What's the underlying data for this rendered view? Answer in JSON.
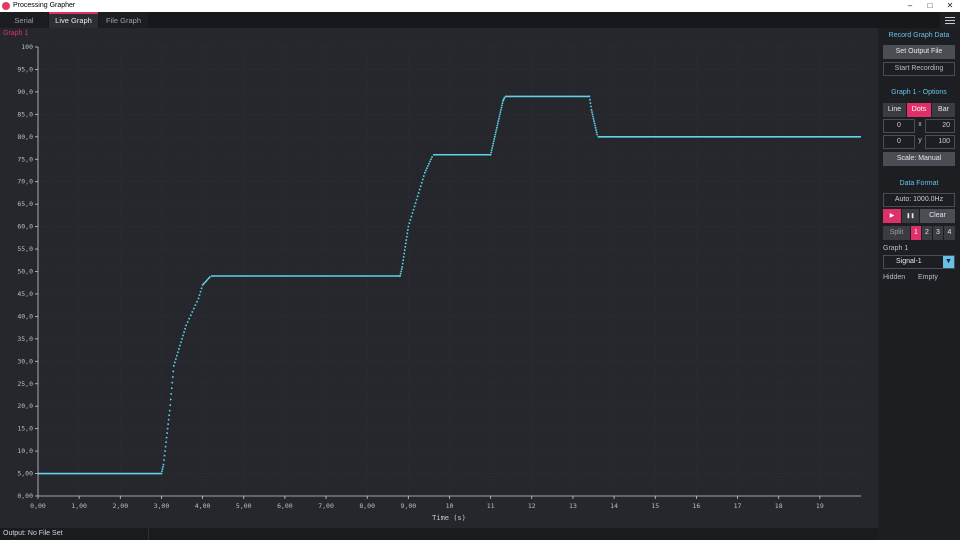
{
  "app": {
    "title": "Processing Grapher"
  },
  "tabs": [
    "Serial",
    "Live Graph",
    "File Graph"
  ],
  "graph": {
    "name": "Graph 1",
    "xlabel": "Time (s)"
  },
  "sidebar": {
    "record_title": "Record Graph Data",
    "set_output_label": "Set Output File",
    "start_recording_label": "Start Recording",
    "options_title": "Graph 1 - Options",
    "type_buttons": [
      "Line",
      "Dots",
      "Bar"
    ],
    "active_type": "Dots",
    "x_min": "0",
    "x_sep": "x",
    "x_max": "20",
    "y_min": "0",
    "y_sep": "y",
    "y_max": "100",
    "scale_label": "Scale: Manual",
    "data_format_title": "Data Format",
    "rate_label": "Auto: 1000.0Hz",
    "play_icon": "▶",
    "pause_icon": "❚❚",
    "clear_label": "Clear",
    "split_label": "Split",
    "split_options": [
      "1",
      "2",
      "3",
      "4"
    ],
    "active_split": "1",
    "graph_select_label": "Graph 1",
    "signal_value": "Signal-1",
    "hidden_label": "Hidden",
    "empty_label": "Empty"
  },
  "status": {
    "text": "Output: No File Set"
  },
  "colors": {
    "accent": "#e0306a",
    "signal": "#5fd3ea",
    "panel_title": "#67c0e8"
  },
  "chart_data": {
    "type": "scatter",
    "xlim": [
      0,
      20
    ],
    "ylim": [
      0,
      100
    ],
    "xticks": [
      "0,00",
      "1,00",
      "2,00",
      "3,00",
      "4,00",
      "5,00",
      "6,00",
      "7,00",
      "8,00",
      "9,00",
      "10",
      "11",
      "12",
      "13",
      "14",
      "15",
      "16",
      "17",
      "18",
      "19"
    ],
    "yticks": [
      "0,00",
      "5,00",
      "10,0",
      "15,0",
      "20,0",
      "25,0",
      "30,0",
      "35,0",
      "40,0",
      "45,0",
      "50,0",
      "55,0",
      "60,0",
      "65,0",
      "70,0",
      "75,0",
      "80,0",
      "85,0",
      "90,0",
      "95,0",
      "100"
    ],
    "grid": true,
    "series": [
      {
        "color": "#5fd3ea",
        "points": [
          [
            0.0,
            5.0
          ],
          [
            3.0,
            5.0
          ],
          [
            3.05,
            7
          ],
          [
            3.1,
            11
          ],
          [
            3.15,
            15
          ],
          [
            3.2,
            19
          ],
          [
            3.25,
            24
          ],
          [
            3.3,
            29
          ],
          [
            3.4,
            32
          ],
          [
            3.5,
            35
          ],
          [
            3.6,
            38
          ],
          [
            3.75,
            41
          ],
          [
            3.9,
            44
          ],
          [
            4.0,
            47
          ],
          [
            4.1,
            48
          ],
          [
            4.2,
            49.0
          ],
          [
            8.8,
            49.0
          ],
          [
            8.85,
            51
          ],
          [
            8.9,
            54
          ],
          [
            8.95,
            57
          ],
          [
            9.0,
            60
          ],
          [
            9.1,
            63
          ],
          [
            9.2,
            66
          ],
          [
            9.3,
            69
          ],
          [
            9.4,
            72
          ],
          [
            9.5,
            74
          ],
          [
            9.6,
            76.0
          ],
          [
            11.0,
            76.0
          ],
          [
            11.05,
            78
          ],
          [
            11.1,
            80
          ],
          [
            11.15,
            82
          ],
          [
            11.2,
            84
          ],
          [
            11.25,
            86
          ],
          [
            11.3,
            88
          ],
          [
            11.35,
            89.0
          ],
          [
            13.4,
            89.0
          ],
          [
            13.45,
            86
          ],
          [
            13.5,
            84
          ],
          [
            13.55,
            82
          ],
          [
            13.6,
            80.0
          ],
          [
            20.0,
            80.0
          ]
        ]
      }
    ]
  }
}
